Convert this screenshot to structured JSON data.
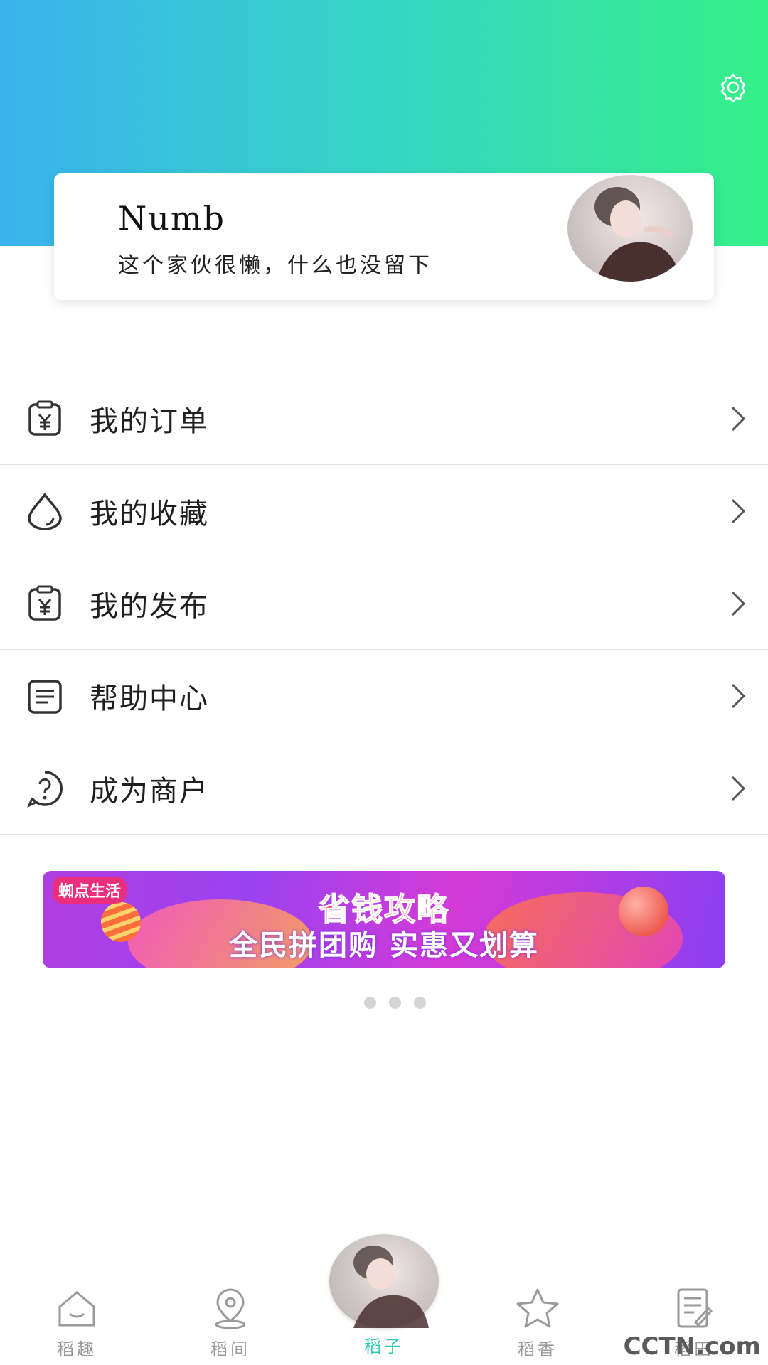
{
  "profile": {
    "name": "Numb",
    "bio": "这个家伙很懒，什么也没留下"
  },
  "menu": [
    {
      "label": "我的订单",
      "icon": "receipt-yen-icon"
    },
    {
      "label": "我的收藏",
      "icon": "droplet-icon"
    },
    {
      "label": "我的发布",
      "icon": "receipt-yen-icon"
    },
    {
      "label": "帮助中心",
      "icon": "document-list-icon"
    },
    {
      "label": "成为商户",
      "icon": "question-circle-icon"
    }
  ],
  "banner": {
    "logo": "蜘点生活",
    "title": "省钱攻略",
    "subtitle": "全民拼团购 实惠又划算"
  },
  "tabs": [
    {
      "label": "稻趣",
      "icon": "home-icon"
    },
    {
      "label": "稻间",
      "icon": "location-pin-icon"
    },
    {
      "label": "稻子",
      "icon": "avatar"
    },
    {
      "label": "稻香",
      "icon": "star-icon"
    },
    {
      "label": "稻田",
      "icon": "note-edit-icon"
    }
  ],
  "active_tab": "稻子",
  "colors": {
    "header_gradient_start": "#3ab2ee",
    "header_gradient_end": "#34f089",
    "active_tab": "#34c7b8",
    "inactive_tab": "#9a9a9a"
  },
  "watermark": "CCTN.com"
}
